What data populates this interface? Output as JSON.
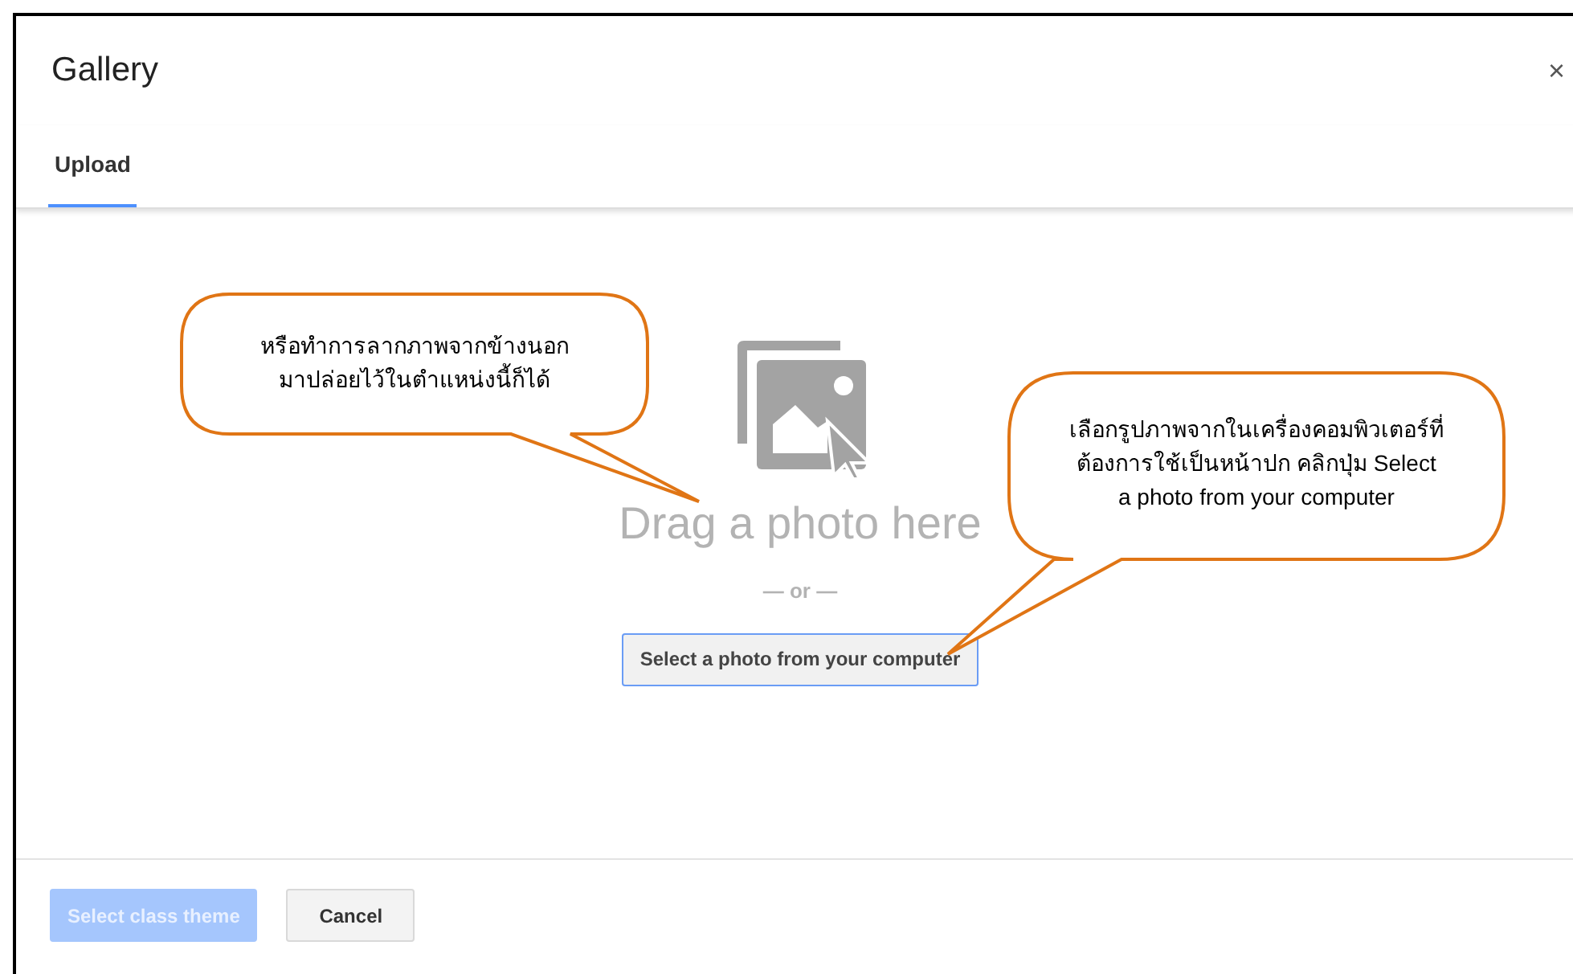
{
  "dialog": {
    "title": "Gallery",
    "close": "×"
  },
  "tabs": [
    {
      "label": "Upload",
      "selected": true
    }
  ],
  "upload": {
    "prompt": "Drag a photo here",
    "separator": "— or —",
    "button": "Select a photo from your computer"
  },
  "footer_buttons": [
    {
      "label": "Select class theme",
      "kind": "primary",
      "disabled": true
    },
    {
      "label": "Cancel",
      "kind": "secondary",
      "disabled": false
    }
  ],
  "callouts": [
    {
      "text": "หรือทำการลากภาพจากข้างนอก\nมาปล่อยไว้ในตำแหน่งนี้ก็ได้"
    },
    {
      "text": "เลือกรูปภาพจากในเครื่องคอมพิวเตอร์ที่\nต้องการใช้เป็นหน้าปก คลิกปุ่ม Select\na photo from your computer"
    }
  ]
}
